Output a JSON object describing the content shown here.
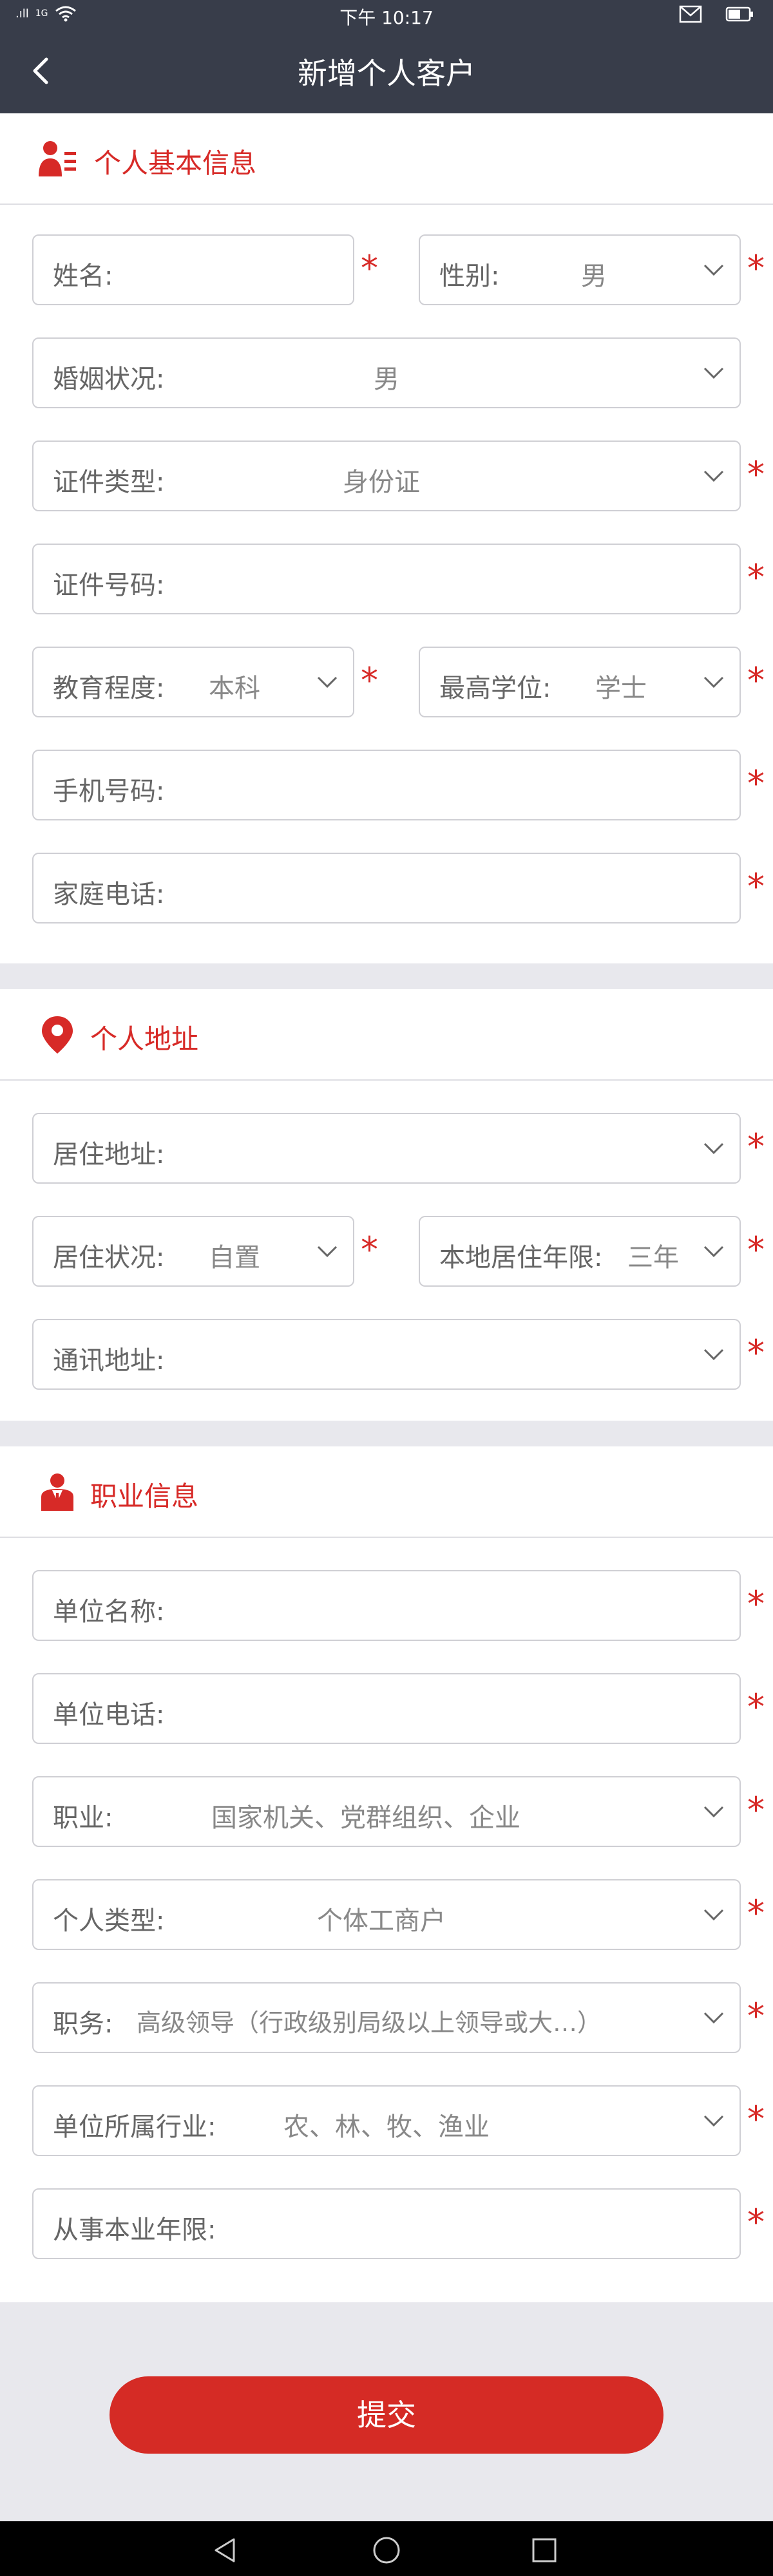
{
  "status_bar": {
    "signal": ".ıll",
    "network": "1G",
    "time": "下午  10:17"
  },
  "header": {
    "title": "新增个人客户"
  },
  "sections": {
    "basic": {
      "title": "个人基本信息",
      "fields": {
        "name": {
          "label": "姓名:"
        },
        "gender": {
          "label": "性别:",
          "value": "男"
        },
        "marital": {
          "label": "婚姻状况:",
          "value": "男"
        },
        "id_type": {
          "label": "证件类型:",
          "value": "身份证"
        },
        "id_number": {
          "label": "证件号码:"
        },
        "education": {
          "label": "教育程度:",
          "value": "本科"
        },
        "degree": {
          "label": "最高学位:",
          "value": "学士"
        },
        "mobile": {
          "label": "手机号码:"
        },
        "home_phone": {
          "label": "家庭电话:"
        }
      }
    },
    "address": {
      "title": "个人地址",
      "fields": {
        "residence": {
          "label": "居住地址:"
        },
        "residence_status": {
          "label": "居住状况:",
          "value": "自置"
        },
        "local_years": {
          "label": "本地居住年限:",
          "value": "三年"
        },
        "mail_address": {
          "label": "通讯地址:"
        }
      }
    },
    "job": {
      "title": "职业信息",
      "fields": {
        "employer": {
          "label": "单位名称:"
        },
        "employer_phone": {
          "label": "单位电话:"
        },
        "occupation": {
          "label": "职业:",
          "value": "国家机关、党群组织、企业"
        },
        "person_type": {
          "label": "个人类型:",
          "value": "个体工商户"
        },
        "position": {
          "label": "职务:",
          "value": "高级领导（行政级别局级以上领导或大…）"
        },
        "industry": {
          "label": "单位所属行业:",
          "value": "农、林、牧、渔业"
        },
        "years_in_industry": {
          "label": "从事本业年限:"
        }
      }
    }
  },
  "required_mark": "*",
  "submit_label": "提交",
  "colors": {
    "accent": "#d72a27",
    "header_bg": "#383d4a",
    "page_bg": "#e8e8ed"
  },
  "icons": [
    "back-arrow-icon",
    "mail-icon",
    "battery-icon",
    "wifi-icon",
    "person-card-icon",
    "location-pin-icon",
    "worker-icon",
    "chevron-down-icon",
    "nav-back-icon",
    "nav-home-icon",
    "nav-recent-icon"
  ]
}
